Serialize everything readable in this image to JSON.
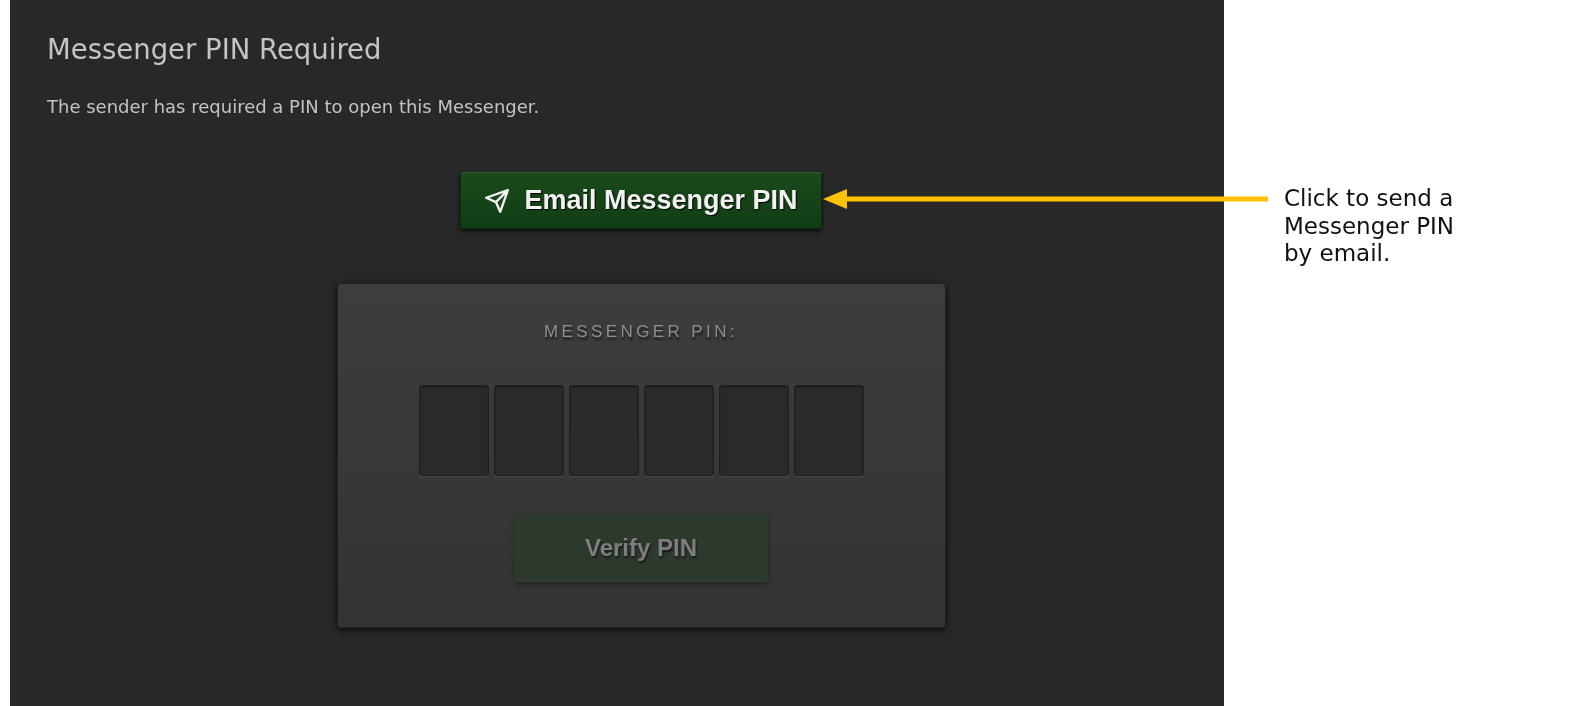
{
  "window": {
    "title": "Messenger PIN Required",
    "message": "The sender has required a PIN to open this Messenger."
  },
  "email_button": {
    "label": "Email Messenger PIN"
  },
  "pin_card": {
    "label": "MESSENGER PIN:",
    "digits": [
      {
        "filled": false
      },
      {
        "filled": false
      },
      {
        "filled": false
      },
      {
        "filled": false
      },
      {
        "filled": false
      },
      {
        "filled": false
      }
    ],
    "verify_button": {
      "label": "Verify PIN",
      "disabled": true
    }
  },
  "callout": {
    "text": "Click to send a Messenger PIN by email."
  }
}
